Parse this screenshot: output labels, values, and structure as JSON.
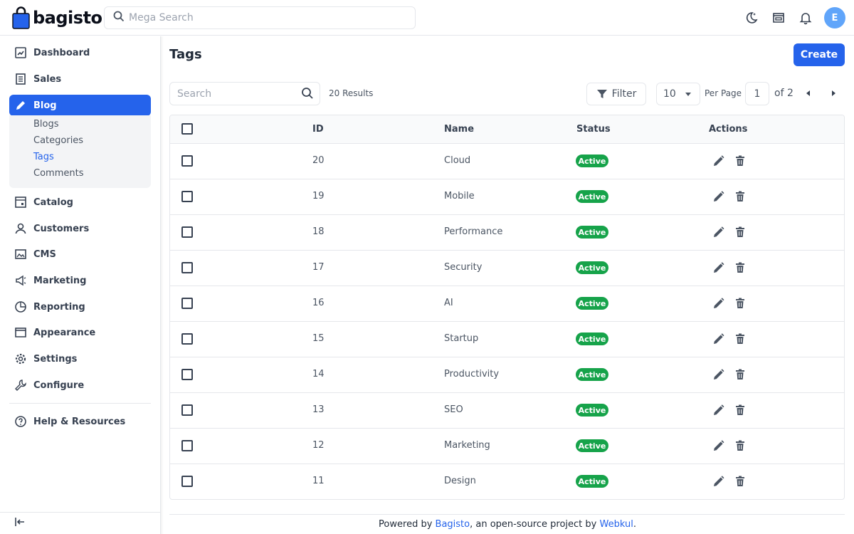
{
  "header": {
    "brand": "bagisto",
    "search_placeholder": "Mega Search",
    "avatar_initial": "E",
    "brand_color": "#2563eb"
  },
  "sidebar": {
    "items": [
      {
        "label": "Dashboard",
        "icon": "dashboard-icon"
      },
      {
        "label": "Sales",
        "icon": "receipt-icon"
      },
      {
        "label": "Blog",
        "icon": "pencil-icon",
        "active": true
      },
      {
        "label": "Catalog",
        "icon": "catalog-icon"
      },
      {
        "label": "Customers",
        "icon": "user-icon"
      },
      {
        "label": "CMS",
        "icon": "image-icon"
      },
      {
        "label": "Marketing",
        "icon": "megaphone-icon"
      },
      {
        "label": "Reporting",
        "icon": "pie-chart-icon"
      },
      {
        "label": "Appearance",
        "icon": "storefront-icon"
      },
      {
        "label": "Settings",
        "icon": "gear-icon"
      },
      {
        "label": "Configure",
        "icon": "wrench-icon"
      }
    ],
    "blog_sub": [
      "Blogs",
      "Categories",
      "Tags",
      "Comments"
    ],
    "help": "Help & Resources"
  },
  "page": {
    "title": "Tags",
    "create_label": "Create"
  },
  "toolbar": {
    "search_placeholder": "Search",
    "results": "20 Results",
    "filter_label": "Filter",
    "per_page_value": "10",
    "per_page_label": "Per Page",
    "page_value": "1",
    "of_label": "of 2"
  },
  "table": {
    "columns": [
      "ID",
      "Name",
      "Status",
      "Actions"
    ],
    "rows": [
      {
        "id": "20",
        "name": "Cloud",
        "status": "Active"
      },
      {
        "id": "19",
        "name": "Mobile",
        "status": "Active"
      },
      {
        "id": "18",
        "name": "Performance",
        "status": "Active"
      },
      {
        "id": "17",
        "name": "Security",
        "status": "Active"
      },
      {
        "id": "16",
        "name": "AI",
        "status": "Active"
      },
      {
        "id": "15",
        "name": "Startup",
        "status": "Active"
      },
      {
        "id": "14",
        "name": "Productivity",
        "status": "Active"
      },
      {
        "id": "13",
        "name": "SEO",
        "status": "Active"
      },
      {
        "id": "12",
        "name": "Marketing",
        "status": "Active"
      },
      {
        "id": "11",
        "name": "Design",
        "status": "Active"
      }
    ]
  },
  "footer": {
    "prefix": "Powered by ",
    "link1": "Bagisto",
    "middle": ", an open-source project by ",
    "link2": "Webkul",
    "suffix": "."
  }
}
